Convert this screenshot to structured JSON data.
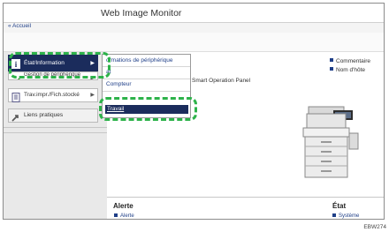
{
  "app": {
    "title": "Web Image Monitor"
  },
  "breadcrumb": {
    "home": "« Accueil"
  },
  "sidebar": {
    "items": [
      {
        "label": "État/Information",
        "icon": "info-icon",
        "has_submenu": true
      },
      {
        "label": "Gestion de périphérique",
        "icon": "checkmark-icon",
        "has_submenu": true
      },
      {
        "label": "Trav.impr./Fich.stocké",
        "icon": "document-icon",
        "has_submenu": true
      },
      {
        "label": "Liens pratiques",
        "icon": "link-icon",
        "has_submenu": false
      }
    ]
  },
  "submenu": {
    "items": [
      {
        "label": "Informations de périphérique",
        "visible_label": "ormations de périphérique"
      },
      {
        "label": "État",
        "visible_label": "at"
      },
      {
        "label": "Compteur",
        "visible_label": "Compteur"
      },
      {
        "label": "Travail",
        "visible_label": "Travail",
        "selected": true
      }
    ]
  },
  "main": {
    "device_name": "Smart Operation Panel",
    "links": [
      "Commentaire",
      "Nom d'hôte"
    ],
    "device_image": "printer-image"
  },
  "alert_panel": {
    "title": "Alerte",
    "items": [
      "Alerte"
    ],
    "state_title": "État",
    "state_items": [
      "Système"
    ]
  },
  "figure_code": "EBW274",
  "colors": {
    "accent": "#1b2c5c",
    "link": "#1f3f88",
    "callout": "#2db24a",
    "sidebar_bg": "#e9e9e9"
  }
}
